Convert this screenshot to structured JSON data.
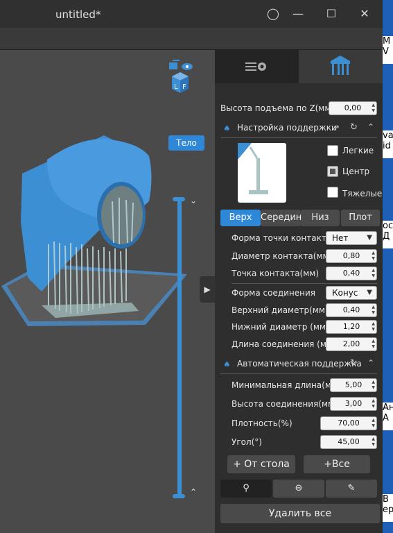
{
  "window": {
    "title": "untitled*"
  },
  "viewport": {
    "view_mode_label": "Тело"
  },
  "panel": {
    "tabs": [
      {
        "name": "settings-tab",
        "icon": "sliders-gear-icon"
      },
      {
        "name": "support-tab",
        "icon": "support-pillars-icon",
        "active": true
      }
    ],
    "z_lift": {
      "label": "Высота подъема по Z(мм)",
      "value": "0,00"
    },
    "support_settings": {
      "header": "Настройка поддержки",
      "checkboxes": [
        "Легкие",
        "Центр",
        "Тяжелые"
      ],
      "selected": "Центр"
    },
    "segment_tabs": [
      "Верх",
      "Середина",
      "Низ",
      "Плот"
    ],
    "active_segment": "Верх",
    "fields_top": [
      {
        "label": "Форма точки контакта",
        "value": "Нет",
        "kind": "combo"
      },
      {
        "label": "Диаметр контакта(мм)",
        "value": "0,80",
        "kind": "spin"
      },
      {
        "label": "Точка контакта(мм)",
        "value": "0,40",
        "kind": "spin"
      }
    ],
    "fields_conn": [
      {
        "label": "Форма соединения",
        "value": "Конус",
        "kind": "combo"
      },
      {
        "label": "Верхний диаметр(мм)",
        "value": "0,40",
        "kind": "spin"
      },
      {
        "label": "Нижний диаметр (мм)",
        "value": "1,20",
        "kind": "spin"
      },
      {
        "label": "Длина соединения (мм)",
        "value": "2,00",
        "kind": "spin"
      }
    ],
    "auto_support": {
      "header": "Автоматическая поддержка",
      "fields": [
        {
          "label": "Минимальная длина(мм)",
          "value": "5,00"
        },
        {
          "label": "Высота соединения(мм)",
          "value": "3,00"
        },
        {
          "label": "Плотность(%)",
          "value": "70,00"
        },
        {
          "label": "Угол(°)",
          "value": "45,00"
        }
      ]
    },
    "buttons": {
      "from_table": "+ От стола",
      "all": "+Все",
      "delete_all": "Удалить все"
    }
  },
  "desktop_fragments": [
    "M",
    "V",
    "va",
    "id",
    "ос",
    "Д",
    "Ан",
    "А",
    "В",
    "ер"
  ],
  "colors": {
    "accent": "#2f87d8",
    "model": "#3d8fd4",
    "support": "#a8c4c4"
  }
}
